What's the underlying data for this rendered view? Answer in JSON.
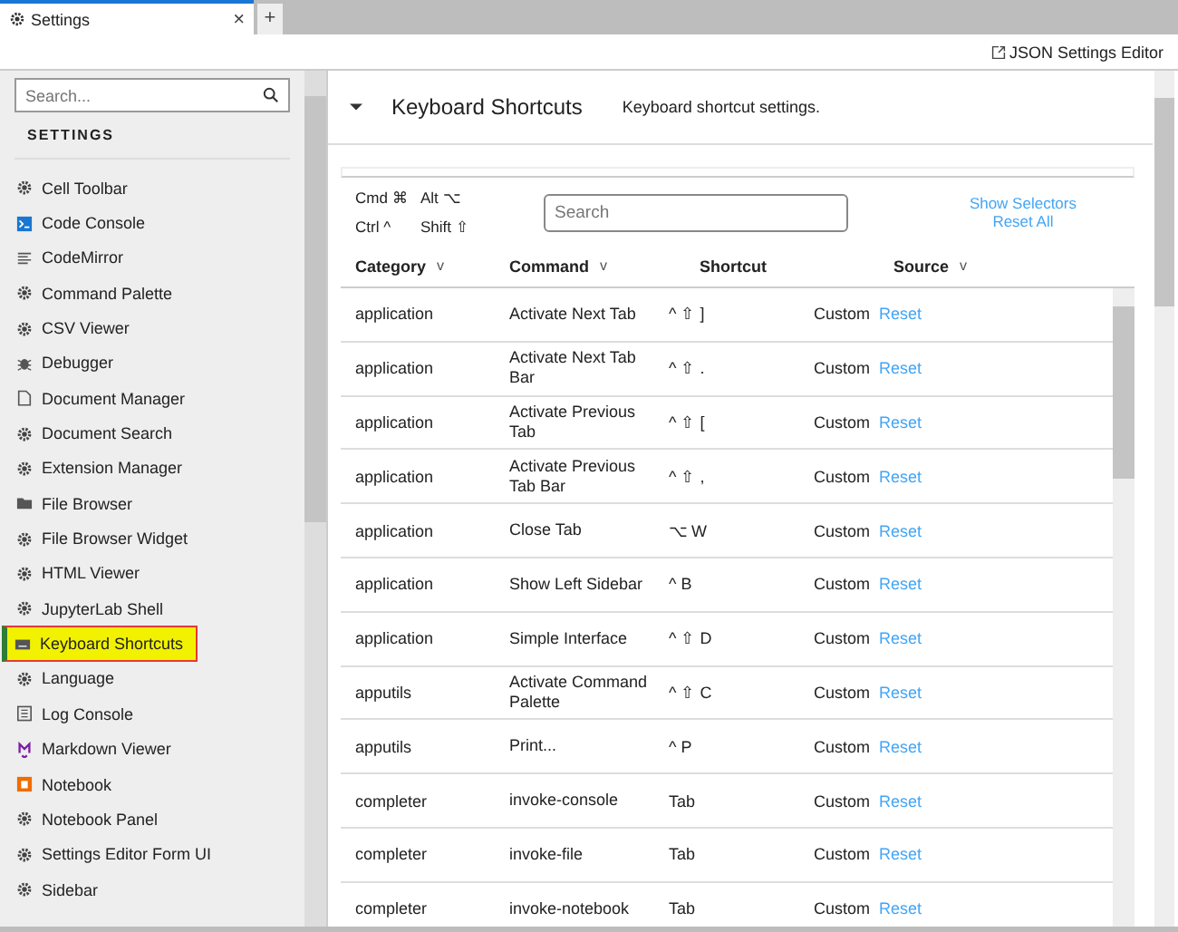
{
  "tabs": [
    {
      "label": "Settings",
      "selected": true,
      "close": "×"
    }
  ],
  "new_tab": "+",
  "toolbar": {
    "json_editor": "JSON Settings Editor"
  },
  "sidebar": {
    "search": {
      "placeholder": "Search..."
    },
    "heading": "SETTINGS",
    "items": [
      {
        "label": "Cell Toolbar",
        "selected": false
      },
      {
        "label": "Code Console",
        "selected": false
      },
      {
        "label": "CodeMirror",
        "selected": false
      },
      {
        "label": "Command Palette",
        "selected": false
      },
      {
        "label": "CSV Viewer",
        "selected": false
      },
      {
        "label": "Debugger",
        "selected": false
      },
      {
        "label": "Document Manager",
        "selected": false
      },
      {
        "label": "Document Search",
        "selected": false
      },
      {
        "label": "Extension Manager",
        "selected": false
      },
      {
        "label": "File Browser",
        "selected": false
      },
      {
        "label": "File Browser Widget",
        "selected": false
      },
      {
        "label": "HTML Viewer",
        "selected": false
      },
      {
        "label": "JupyterLab Shell",
        "selected": false
      },
      {
        "label": "Keyboard Shortcuts",
        "selected": true
      },
      {
        "label": "Language",
        "selected": false
      },
      {
        "label": "Log Console",
        "selected": false
      },
      {
        "label": "Markdown Viewer",
        "selected": false
      },
      {
        "label": "Notebook",
        "selected": false
      },
      {
        "label": "Notebook Panel",
        "selected": false
      },
      {
        "label": "Settings Editor Form UI",
        "selected": false
      },
      {
        "label": "Sidebar",
        "selected": false
      }
    ]
  },
  "section": {
    "title": "Keyboard Shortcuts",
    "description": "Keyboard shortcut settings.",
    "expanded": true
  },
  "legend": [
    {
      "label": "Cmd",
      "symbol": "⌘"
    },
    {
      "label": "Alt",
      "symbol": "⌥"
    },
    {
      "label": "Ctrl",
      "symbol": "^"
    },
    {
      "label": "Shift",
      "symbol": "⇧"
    }
  ],
  "search": {
    "placeholder": "Search"
  },
  "links": [
    "Show Selectors",
    "Reset All"
  ],
  "table": {
    "columns": [
      {
        "label": "Category",
        "sort": "v"
      },
      {
        "label": "Command",
        "sort": "v"
      },
      {
        "label": "Shortcut"
      },
      {
        "label": "Source",
        "sort": "v"
      }
    ],
    "rows": [
      {
        "category": "application",
        "command": "Activate Next Tab",
        "shortcut": "^ ⇧ ]",
        "source": "Custom",
        "action": "Reset"
      },
      {
        "category": "application",
        "command": "Activate Next Tab Bar",
        "shortcut": "^ ⇧ .",
        "source": "Custom",
        "action": "Reset"
      },
      {
        "category": "application",
        "command": "Activate Previous Tab",
        "shortcut": "^ ⇧ [",
        "source": "Custom",
        "action": "Reset"
      },
      {
        "category": "application",
        "command": "Activate Previous Tab Bar",
        "shortcut": "^ ⇧ ,",
        "source": "Custom",
        "action": "Reset"
      },
      {
        "category": "application",
        "command": "Close Tab",
        "shortcut": "⌥ W",
        "source": "Custom",
        "action": "Reset"
      },
      {
        "category": "application",
        "command": "Show Left Sidebar",
        "shortcut": "^ B",
        "source": "Custom",
        "action": "Reset"
      },
      {
        "category": "application",
        "command": "Simple Interface",
        "shortcut": "^ ⇧ D",
        "source": "Custom",
        "action": "Reset"
      },
      {
        "category": "apputils",
        "command": "Activate Command Palette",
        "shortcut": "^ ⇧ C",
        "source": "Custom",
        "action": "Reset"
      },
      {
        "category": "apputils",
        "command": "Print...",
        "shortcut": "^ P",
        "source": "Custom",
        "action": "Reset"
      },
      {
        "category": "completer",
        "command": "invoke-console",
        "shortcut": "Tab",
        "source": "Custom",
        "action": "Reset"
      },
      {
        "category": "completer",
        "command": "invoke-file",
        "shortcut": "Tab",
        "source": "Custom",
        "action": "Reset"
      },
      {
        "category": "completer",
        "command": "invoke-notebook",
        "shortcut": "Tab",
        "source": "Custom",
        "action": "Reset"
      }
    ]
  }
}
